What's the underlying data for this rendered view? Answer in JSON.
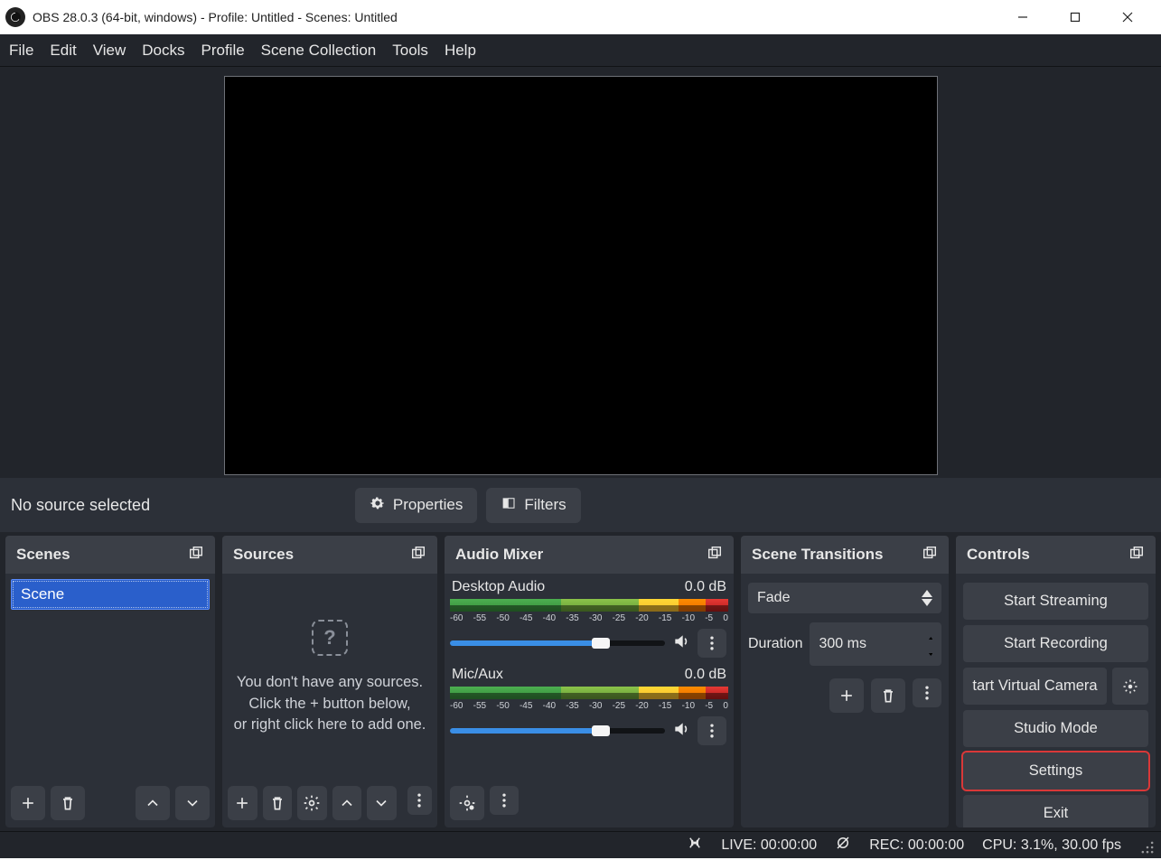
{
  "window": {
    "title": "OBS 28.0.3 (64-bit, windows) - Profile: Untitled - Scenes: Untitled"
  },
  "menu": {
    "file": "File",
    "edit": "Edit",
    "view": "View",
    "docks": "Docks",
    "profile": "Profile",
    "scene_collection": "Scene Collection",
    "tools": "Tools",
    "help": "Help"
  },
  "toolbar": {
    "no_source": "No source selected",
    "properties": "Properties",
    "filters": "Filters"
  },
  "scenes": {
    "title": "Scenes",
    "items": [
      {
        "label": "Scene"
      }
    ]
  },
  "sources": {
    "title": "Sources",
    "empty_line1": "You don't have any sources.",
    "empty_line2": "Click the + button below,",
    "empty_line3": "or right click here to add one."
  },
  "mixer": {
    "title": "Audio Mixer",
    "channels": [
      {
        "name": "Desktop Audio",
        "db": "0.0 dB"
      },
      {
        "name": "Mic/Aux",
        "db": "0.0 dB"
      }
    ],
    "ticks": [
      "-60",
      "-55",
      "-50",
      "-45",
      "-40",
      "-35",
      "-30",
      "-25",
      "-20",
      "-15",
      "-10",
      "-5",
      "0"
    ]
  },
  "transitions": {
    "title": "Scene Transitions",
    "selected": "Fade",
    "duration_label": "Duration",
    "duration_value": "300 ms"
  },
  "controls": {
    "title": "Controls",
    "start_streaming": "Start Streaming",
    "start_recording": "Start Recording",
    "start_virtualcam": "tart Virtual Camera",
    "studio_mode": "Studio Mode",
    "settings": "Settings",
    "exit": "Exit"
  },
  "status": {
    "live": "LIVE: 00:00:00",
    "rec": "REC: 00:00:00",
    "cpu": "CPU: 3.1%, 30.00 fps"
  }
}
